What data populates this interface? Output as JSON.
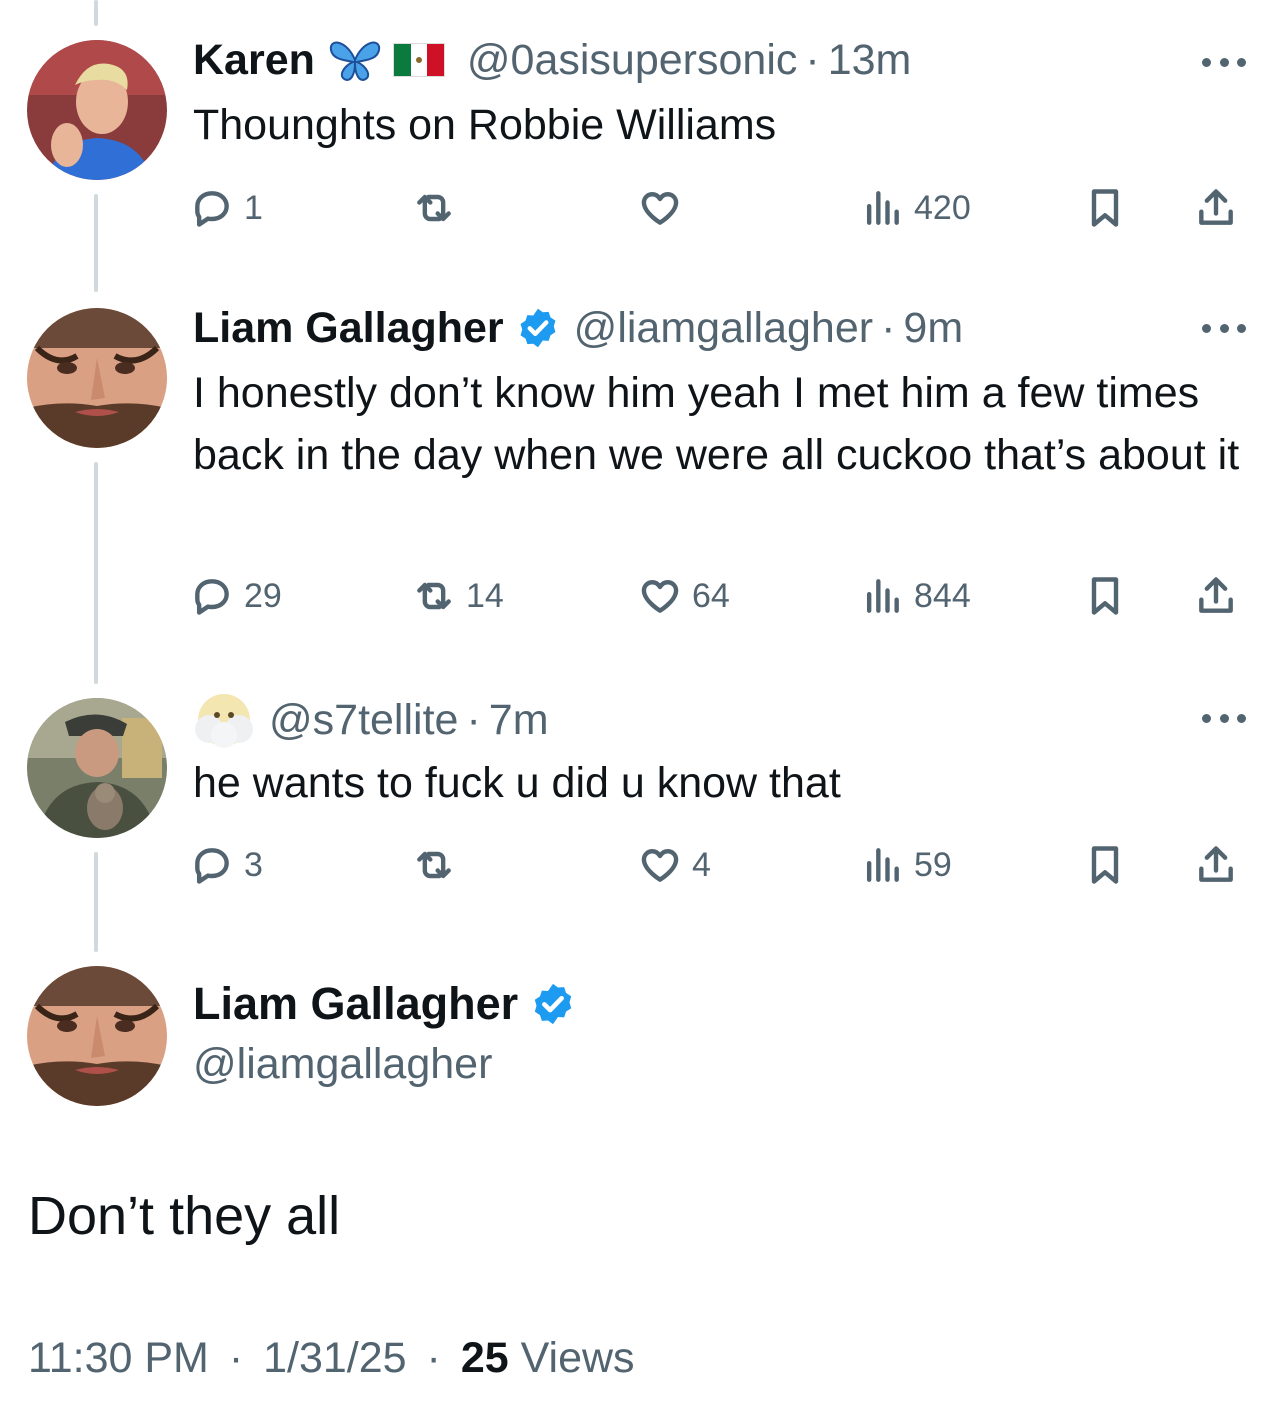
{
  "thread": [
    {
      "avatar": "avatar-blond-man",
      "name": "Karen",
      "name_emoji": "🦋",
      "name_flag": "mexico-flag",
      "handle": "@0asisupersonic",
      "time": "13m",
      "text": "Thounghts on Robbie Williams",
      "stats": {
        "replies": "1",
        "reposts": "",
        "likes": "",
        "views": "420"
      }
    },
    {
      "avatar": "avatar-bearded-man",
      "name": "Liam Gallagher",
      "verified": true,
      "handle": "@liamgallagher",
      "time": "9m",
      "text": "I honestly don’t know him yeah I met him a few times back in the day when we were all cuckoo that’s about it",
      "stats": {
        "replies": "29",
        "reposts": "14",
        "likes": "64",
        "views": "844"
      }
    },
    {
      "avatar": "avatar-man-with-cat",
      "name_emoji": "😶‍🌫️",
      "handle": "@s7tellite",
      "time": "7m",
      "text": "he wants to fuck u did u know that",
      "stats": {
        "replies": "3",
        "reposts": "",
        "likes": "4",
        "views": "59"
      }
    }
  ],
  "main_tweet": {
    "avatar": "avatar-bearded-man",
    "name": "Liam Gallagher",
    "verified": true,
    "handle": "@liamgallagher",
    "text": "Don’t they all",
    "time": "11:30 PM",
    "date": "1/31/25",
    "views_count": "25",
    "views_label": "Views"
  },
  "separator": "·",
  "colors": {
    "verified": "#1d9bf0",
    "muted": "#536471",
    "text": "#0f1419",
    "thread_line": "#cfd9de"
  }
}
